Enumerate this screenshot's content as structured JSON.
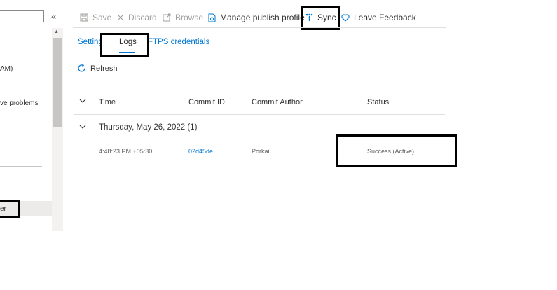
{
  "sidebar": {
    "collapse_icon": "«",
    "items": [
      "AM)",
      "ve problems",
      "er"
    ]
  },
  "toolbar": {
    "save": "Save",
    "discard": "Discard",
    "browse": "Browse",
    "manage_publish_profile": "Manage publish profile",
    "sync": "Sync",
    "leave_feedback": "Leave Feedback"
  },
  "tabs": {
    "settings": "Settings",
    "logs": "Logs",
    "ftps": "FTPS credentials"
  },
  "refresh_label": "Refresh",
  "table": {
    "headers": {
      "time": "Time",
      "commit_id": "Commit ID",
      "commit_author": "Commit Author",
      "status": "Status"
    },
    "group_title": "Thursday, May 26, 2022 (1)",
    "rows": [
      {
        "time": "4:48:23 PM +05:30",
        "commit_id": "02d45de",
        "author": "Porkai",
        "status": "Success (Active)"
      }
    ]
  },
  "colors": {
    "accent": "#0078d4",
    "disabled": "#a19f9d",
    "text": "#323130"
  }
}
